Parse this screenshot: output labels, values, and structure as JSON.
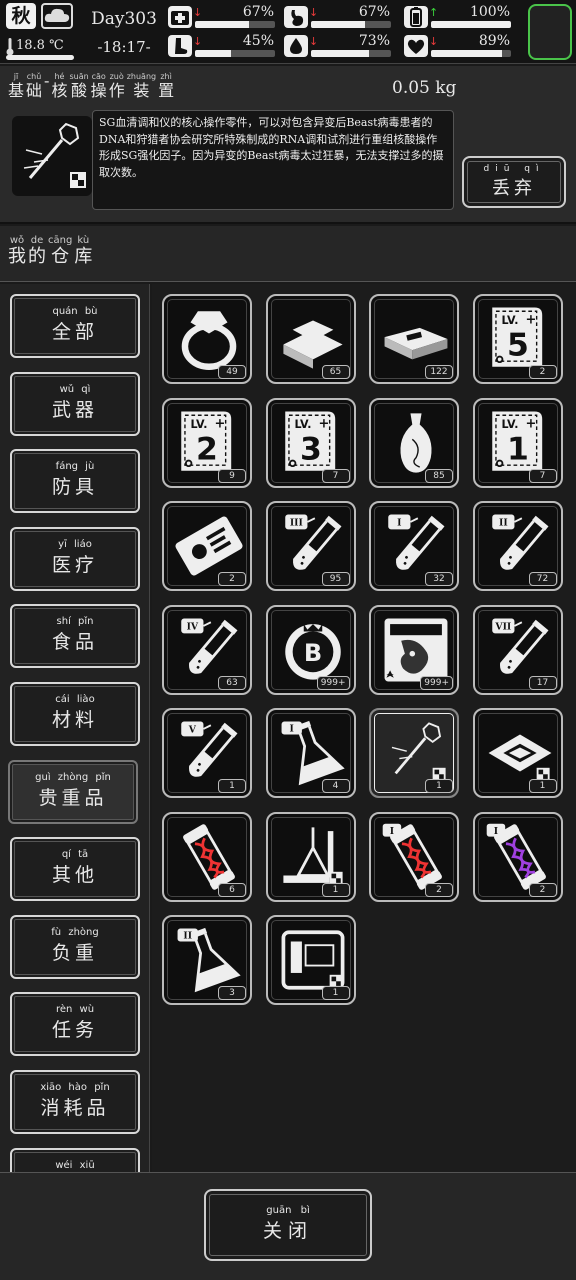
{
  "status": {
    "season": "秋",
    "temperature": "18.8 ℃",
    "day": "Day303",
    "time": "-18:17-",
    "stats": [
      {
        "name": "health",
        "icon": "medkit-icon",
        "arrow": "↓",
        "arrow_color": "#e83a3a",
        "value": "67%",
        "level": 0.67
      },
      {
        "name": "hunger",
        "icon": "stomach-icon",
        "arrow": "↓",
        "arrow_color": "#e83a3a",
        "value": "67%",
        "level": 0.67
      },
      {
        "name": "energy",
        "icon": "battery-icon",
        "arrow": "↑",
        "arrow_color": "#3bd13b",
        "value": "100%",
        "level": 1.0
      },
      {
        "name": "stamina",
        "icon": "foot-icon",
        "arrow": "↓",
        "arrow_color": "#e83a3a",
        "value": "45%",
        "level": 0.45
      },
      {
        "name": "thirst",
        "icon": "water-drop-icon",
        "arrow": "↓",
        "arrow_color": "#e83a3a",
        "value": "73%",
        "level": 0.73
      },
      {
        "name": "mood",
        "icon": "heart-icon",
        "arrow": "↓",
        "arrow_color": "#e83a3a",
        "value": "89%",
        "level": 0.89
      }
    ]
  },
  "item_detail": {
    "title": [
      {
        "py": "jī",
        "hz": "基"
      },
      {
        "py": "chǔ",
        "hz": "础"
      },
      {
        "py": "",
        "hz": "-"
      },
      {
        "py": "hé",
        "hz": "核"
      },
      {
        "py": "suān",
        "hz": "酸"
      },
      {
        "py": "cāo",
        "hz": "操"
      },
      {
        "py": "zuò",
        "hz": "作"
      },
      {
        "py": "zhuāng",
        "hz": "装"
      },
      {
        "py": "zhì",
        "hz": "置"
      }
    ],
    "weight": "0.05 kg",
    "description": "SG血清调和仪的核心操作零件，可以对包含异变后Beast病毒患者的DNA和狩猎者协会研究所特殊制成的RNA调和试剂进行重组核酸操作形成SG强化因子。因为异变的Beast病毒太过狂暴，无法支撑过多的摄取次数。",
    "discard": {
      "py": "diū qì",
      "label": "丢弃"
    }
  },
  "warehouse": {
    "title": [
      {
        "py": "wǒ",
        "hz": "我"
      },
      {
        "py": "de",
        "hz": "的"
      },
      {
        "py": "cāng",
        "hz": "仓"
      },
      {
        "py": "kù",
        "hz": "库"
      }
    ]
  },
  "categories": [
    {
      "py": "quán bù",
      "label": "全部"
    },
    {
      "py": "wǔ qì",
      "label": "武器"
    },
    {
      "py": "fáng jù",
      "label": "防具"
    },
    {
      "py": "yī liáo",
      "label": "医疗"
    },
    {
      "py": "shí pǐn",
      "label": "食品"
    },
    {
      "py": "cái liào",
      "label": "材料"
    },
    {
      "py": "guì zhòng pǐn",
      "label": "贵重品"
    },
    {
      "py": "qí tā",
      "label": "其他"
    },
    {
      "py": "fù zhòng",
      "label": "负重"
    },
    {
      "py": "rèn wù",
      "label": "任务"
    },
    {
      "py": "xiāo hào pǐn",
      "label": "消耗品"
    },
    {
      "py": "wéi xiū",
      "label": ""
    }
  ],
  "active_category": 6,
  "items": [
    {
      "icon": "ring-icon",
      "count": "49"
    },
    {
      "icon": "gold-bars-icon",
      "count": "65"
    },
    {
      "icon": "cash-stack-icon",
      "count": "122"
    },
    {
      "icon": "skill-book-lv5-icon",
      "count": "2",
      "level": "5"
    },
    {
      "icon": "skill-book-lv2-icon",
      "count": "9",
      "level": "2"
    },
    {
      "icon": "skill-book-lv3-icon",
      "count": "7",
      "level": "3"
    },
    {
      "icon": "porcelain-vase-icon",
      "count": "85"
    },
    {
      "icon": "skill-book-lv1-icon",
      "count": "7",
      "level": "1"
    },
    {
      "icon": "id-card-icon",
      "count": "2"
    },
    {
      "icon": "test-tube-iii-icon",
      "count": "95",
      "tier": "III"
    },
    {
      "icon": "test-tube-i-icon",
      "count": "32",
      "tier": "I"
    },
    {
      "icon": "test-tube-ii-icon",
      "count": "72",
      "tier": "II"
    },
    {
      "icon": "test-tube-iv-icon",
      "count": "63",
      "tier": "IV"
    },
    {
      "icon": "b-coin-icon",
      "count": "999+"
    },
    {
      "icon": "monster-photo-icon",
      "count": "999+"
    },
    {
      "icon": "test-tube-vii-icon",
      "count": "17",
      "tier": "VII"
    },
    {
      "icon": "test-tube-v-icon",
      "count": "1",
      "tier": "V"
    },
    {
      "icon": "flask-i-icon",
      "count": "4",
      "tier": "I"
    },
    {
      "icon": "nucleic-acid-tool-icon",
      "count": "1"
    },
    {
      "icon": "microchip-icon",
      "count": "1"
    },
    {
      "icon": "dna-capsule-red-icon",
      "count": "6"
    },
    {
      "icon": "lab-glassware-icon",
      "count": "1"
    },
    {
      "icon": "dna-capsule-i-icon",
      "count": "2",
      "tier": "I"
    },
    {
      "icon": "dna-capsule-blue-i-icon",
      "count": "2",
      "tier": "I"
    },
    {
      "icon": "flask-ii-icon",
      "count": "3",
      "tier": "II"
    },
    {
      "icon": "machine-device-icon",
      "count": "1"
    }
  ],
  "selected_item": 18,
  "close_button": {
    "py": "guān bì",
    "label": "关闭"
  }
}
